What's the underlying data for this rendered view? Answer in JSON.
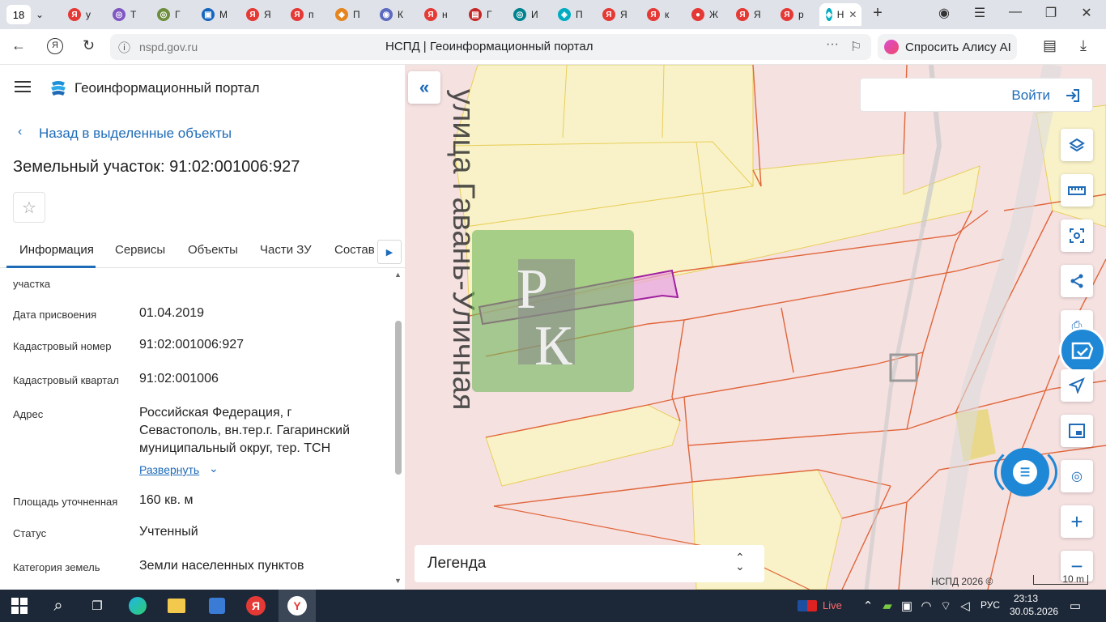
{
  "browser": {
    "tab_count": "18",
    "tabs": [
      {
        "label": "у",
        "color": "#e53935",
        "glyph": "Я"
      },
      {
        "label": "Т",
        "color": "#7e57c2",
        "glyph": "◎"
      },
      {
        "label": "Г",
        "color": "#6d8f3d",
        "glyph": "◎"
      },
      {
        "label": "М",
        "color": "#1565c0",
        "glyph": "▣"
      },
      {
        "label": "Я",
        "color": "#e53935",
        "glyph": "Я"
      },
      {
        "label": "п",
        "color": "#e53935",
        "glyph": "Я"
      },
      {
        "label": "П",
        "color": "#e6851e",
        "glyph": "◆"
      },
      {
        "label": "К",
        "color": "#5c6bc0",
        "glyph": "◉"
      },
      {
        "label": "н",
        "color": "#e53935",
        "glyph": "Я"
      },
      {
        "label": "Г",
        "color": "#c62828",
        "glyph": "▤"
      },
      {
        "label": "И",
        "color": "#00838f",
        "glyph": "◎"
      },
      {
        "label": "П",
        "color": "#00acc1",
        "glyph": "◈"
      },
      {
        "label": "Я",
        "color": "#e53935",
        "glyph": "Я"
      },
      {
        "label": "к",
        "color": "#e53935",
        "glyph": "Я"
      },
      {
        "label": "Ж",
        "color": "#e53935",
        "glyph": "●"
      },
      {
        "label": "Я",
        "color": "#e53935",
        "glyph": "Я"
      },
      {
        "label": "р",
        "color": "#e53935",
        "glyph": "Я"
      }
    ],
    "active_tab_label": "Н",
    "url_host": "nspd.gov.ru",
    "page_title": "НСПД | Геоинформационный портал",
    "alice_label": "Спросить Алису AI"
  },
  "panel": {
    "portal_title": "Геоинформационный портал",
    "back_label": "Назад в выделенные объекты",
    "object_title": "Земельный участок: 91:02:001006:927",
    "tabs": [
      "Информация",
      "Сервисы",
      "Объекты",
      "Части ЗУ",
      "Состав"
    ],
    "fields": {
      "partial_label": "участка",
      "assigned_date_label": "Дата присвоения",
      "assigned_date": "01.04.2019",
      "cad_number_label": "Кадастровый номер",
      "cad_number": "91:02:001006:927",
      "cad_quarter_label": "Кадастровый квартал",
      "cad_quarter": "91:02:001006",
      "address_label": "Адрес",
      "address_line1": "Российская Федерация, г",
      "address_line2": "Севастополь, вн.тер.г. Гагаринский",
      "address_line3": "муниципальный округ, тер. ТСН",
      "expand_label": "Развернуть",
      "area_label": "Площадь уточненная",
      "area_value": "160 кв. м",
      "status_label": "Статус",
      "status_value": "Учтенный",
      "land_category_label": "Категория земель",
      "land_category_value": "Земли населенных пунктов"
    }
  },
  "map": {
    "street_label": "ул. Гавань-Уличная",
    "login_label": "Войти",
    "legend_label": "Легенда",
    "copyright": "НСПД 2026 ©",
    "scale_label": "10 m",
    "watermark_letters": "РК",
    "colors": {
      "parcel_fill": "#f6e1e1",
      "yellow_fill": "#f9f2c8",
      "boundary": "#e0663a",
      "selected": "#a020a0",
      "accent": "#1e6bb8"
    }
  },
  "taskbar": {
    "live_label": "Live",
    "lang": "РУС",
    "time": "23:13",
    "date": "30.05.2026"
  }
}
